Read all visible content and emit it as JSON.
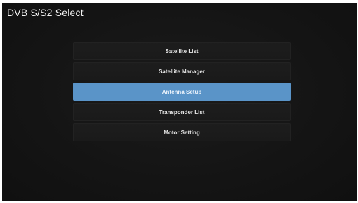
{
  "header": {
    "title": "DVB S/S2 Select"
  },
  "menu": {
    "selected_index": 2,
    "selected_color": "#5a94c8",
    "items": [
      {
        "label": "Satellite List"
      },
      {
        "label": "Satellite Manager"
      },
      {
        "label": "Antenna Setup"
      },
      {
        "label": "Transponder List"
      },
      {
        "label": "Motor Setting"
      }
    ]
  }
}
